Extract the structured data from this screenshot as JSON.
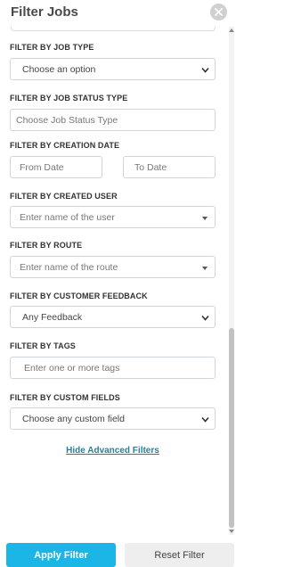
{
  "header": {
    "title": "Filter Jobs",
    "close_icon": "close-icon"
  },
  "filters": {
    "job_type": {
      "label": "FILTER BY JOB TYPE",
      "value": "Choose an option"
    },
    "job_status_type": {
      "label": "FILTER BY JOB STATUS TYPE",
      "placeholder": "Choose Job Status Type"
    },
    "creation_date": {
      "label": "FILTER BY CREATION DATE",
      "from_placeholder": "From Date",
      "to_placeholder": "To Date"
    },
    "created_user": {
      "label": "FILTER BY CREATED USER",
      "placeholder": "Enter name of the user"
    },
    "route": {
      "label": "FILTER BY ROUTE",
      "placeholder": "Enter name of the route"
    },
    "customer_feedback": {
      "label": "FILTER BY CUSTOMER FEEDBACK",
      "value": "Any Feedback"
    },
    "tags": {
      "label": "FILTER BY TAGS",
      "placeholder": "Enter one or more tags"
    },
    "custom_fields": {
      "label": "FILTER BY CUSTOM FIELDS",
      "value": "Choose any custom field"
    }
  },
  "advanced_link": "Hide Advanced Filters",
  "footer": {
    "apply_label": "Apply Filter",
    "reset_label": "Reset Filter"
  },
  "colors": {
    "accent": "#1cb6e6",
    "link": "#2a7fa0",
    "border": "#cfd6dc"
  }
}
